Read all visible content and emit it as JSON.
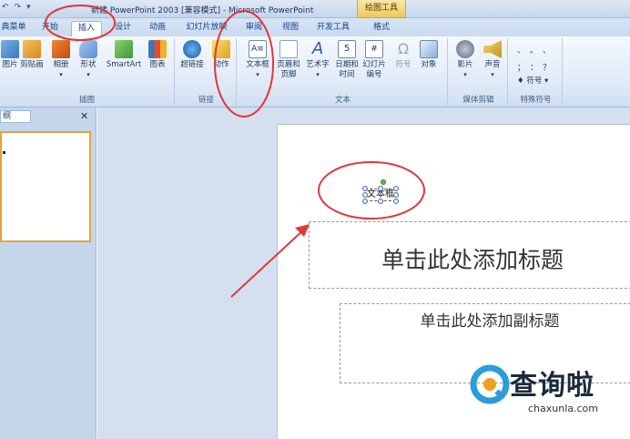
{
  "titlebar": {
    "qat": [
      "↶",
      "↷",
      "▾"
    ],
    "title": "新建 PowerPoint 2003 [兼容模式] - Microsoft PowerPoint",
    "context_tool": "绘图工具"
  },
  "tabs": [
    {
      "label": "典菜单",
      "active": false
    },
    {
      "label": "开始",
      "active": false
    },
    {
      "label": "插入",
      "active": true
    },
    {
      "label": "设计",
      "active": false
    },
    {
      "label": "动画",
      "active": false
    },
    {
      "label": "幻灯片放映",
      "active": false
    },
    {
      "label": "审阅",
      "active": false
    },
    {
      "label": "视图",
      "active": false
    },
    {
      "label": "开发工具",
      "active": false
    },
    {
      "label": "格式",
      "active": false
    }
  ],
  "ribbon": {
    "illustrations": {
      "label": "插图",
      "buttons": [
        "图片",
        "剪贴画",
        "相册",
        "形状",
        "SmartArt",
        "图表"
      ]
    },
    "links": {
      "label": "链接",
      "buttons": [
        "超链接",
        "动作"
      ]
    },
    "text": {
      "label": "文本",
      "buttons": [
        "文本框",
        "页眉和\n页脚",
        "艺术字",
        "日期和\n时间",
        "幻灯片\n编号",
        "符号",
        "对象"
      ]
    },
    "media": {
      "label": "媒体剪辑",
      "buttons": [
        "影片",
        "声音"
      ]
    },
    "special": {
      "label": "特殊符号",
      "symbols": [
        "、",
        "。",
        "、",
        "；",
        "：",
        "？"
      ],
      "button": "符号"
    }
  },
  "leftpane": {
    "tab": "纲",
    "close": "✕"
  },
  "slide": {
    "textbox": "文本框",
    "title_placeholder": "单击此处添加标题",
    "subtitle_placeholder": "单击此处添加副标题"
  },
  "watermark": {
    "brand": "查询啦",
    "url": "chaxunla.com"
  },
  "colors": {
    "annotation": "#e0373a",
    "ribbon": "#dfe9f6",
    "accent": "#15428b"
  }
}
